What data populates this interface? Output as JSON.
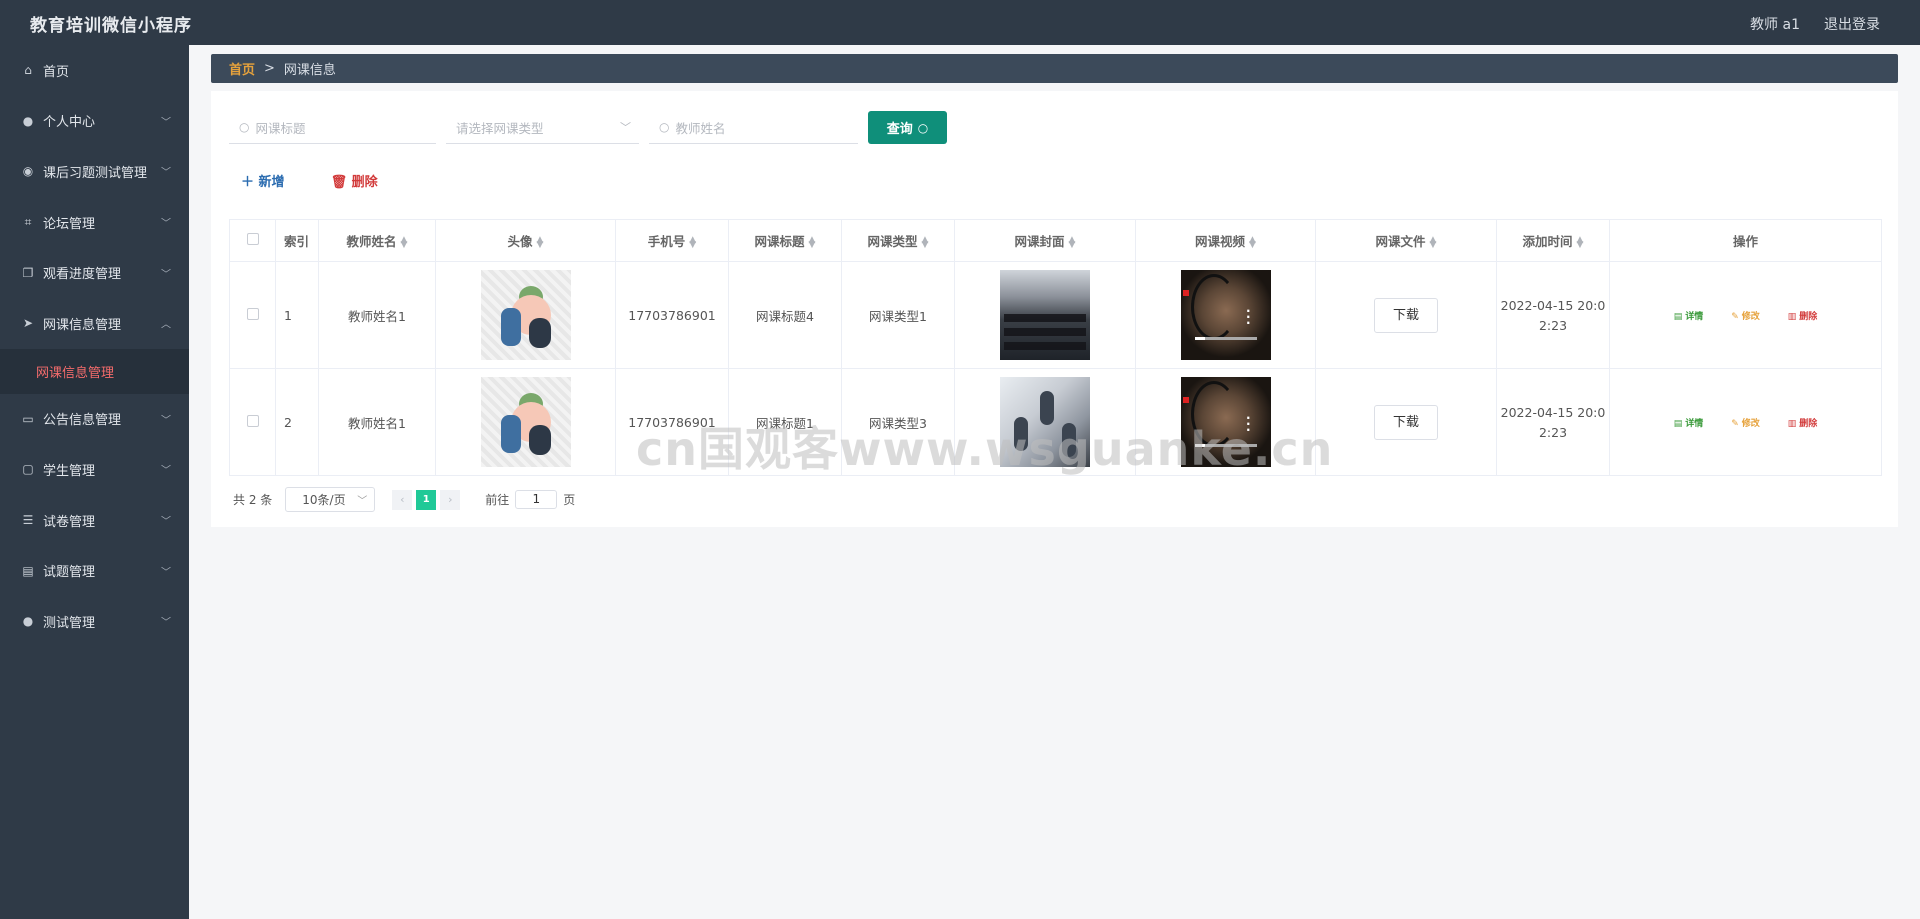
{
  "header": {
    "app_title": "教育培训微信小程序",
    "user_label": "教师 a1",
    "logout_label": "退出登录"
  },
  "sidebar": {
    "items": [
      {
        "label": "首页",
        "icon": "home-icon",
        "has_children": false
      },
      {
        "label": "个人中心",
        "icon": "user-icon",
        "has_children": true
      },
      {
        "label": "课后习题测试管理",
        "icon": "location-icon",
        "has_children": true
      },
      {
        "label": "论坛管理",
        "icon": "crop-icon",
        "has_children": true
      },
      {
        "label": "观看进度管理",
        "icon": "copy-icon",
        "has_children": true
      },
      {
        "label": "网课信息管理",
        "icon": "send-icon",
        "has_children": true,
        "expanded": true
      },
      {
        "label": "公告信息管理",
        "icon": "monitor-icon",
        "has_children": true
      },
      {
        "label": "学生管理",
        "icon": "chat-icon",
        "has_children": true
      },
      {
        "label": "试卷管理",
        "icon": "list-icon",
        "has_children": true
      },
      {
        "label": "试题管理",
        "icon": "card-icon",
        "has_children": true
      },
      {
        "label": "测试管理",
        "icon": "user-icon",
        "has_children": true
      }
    ],
    "active_sub": "网课信息管理"
  },
  "breadcrumb": {
    "home": "首页",
    "separator": ">",
    "current": "网课信息"
  },
  "search": {
    "title_placeholder": "网课标题",
    "type_placeholder": "请选择网课类型",
    "teacher_placeholder": "教师姓名",
    "query_label": "查询"
  },
  "actions": {
    "add_label": "新增",
    "delete_label": "删除"
  },
  "table": {
    "headers": [
      "索引",
      "教师姓名",
      "头像",
      "手机号",
      "网课标题",
      "网课类型",
      "网课封面",
      "网课视频",
      "网课文件",
      "添加时间",
      "操作"
    ],
    "rows": [
      {
        "index": "1",
        "teacher": "教师姓名1",
        "phone": "17703786901",
        "title": "网课标题4",
        "type": "网课类型1",
        "file_button": "下载",
        "time_line1": "2022-04-15 20:0",
        "time_line2": "2:23"
      },
      {
        "index": "2",
        "teacher": "教师姓名1",
        "phone": "17703786901",
        "title": "网课标题1",
        "type": "网课类型3",
        "file_button": "下载",
        "time_line1": "2022-04-15 20:0",
        "time_line2": "2:23"
      }
    ],
    "ops": {
      "detail": "详情",
      "edit": "修改",
      "delete": "删除"
    }
  },
  "pagination": {
    "total": "共 2 条",
    "page_size": "10条/页",
    "current_page": "1",
    "goto_label": "前往",
    "goto_value": "1",
    "page_suffix": "页"
  },
  "watermark": "cn国观客www.wsguanke.cn",
  "colors": {
    "sidebar_bg": "#2f3a47",
    "accent": "#0f8f7a",
    "active_sub": "#f56c6c",
    "pager_active": "#20c997"
  }
}
